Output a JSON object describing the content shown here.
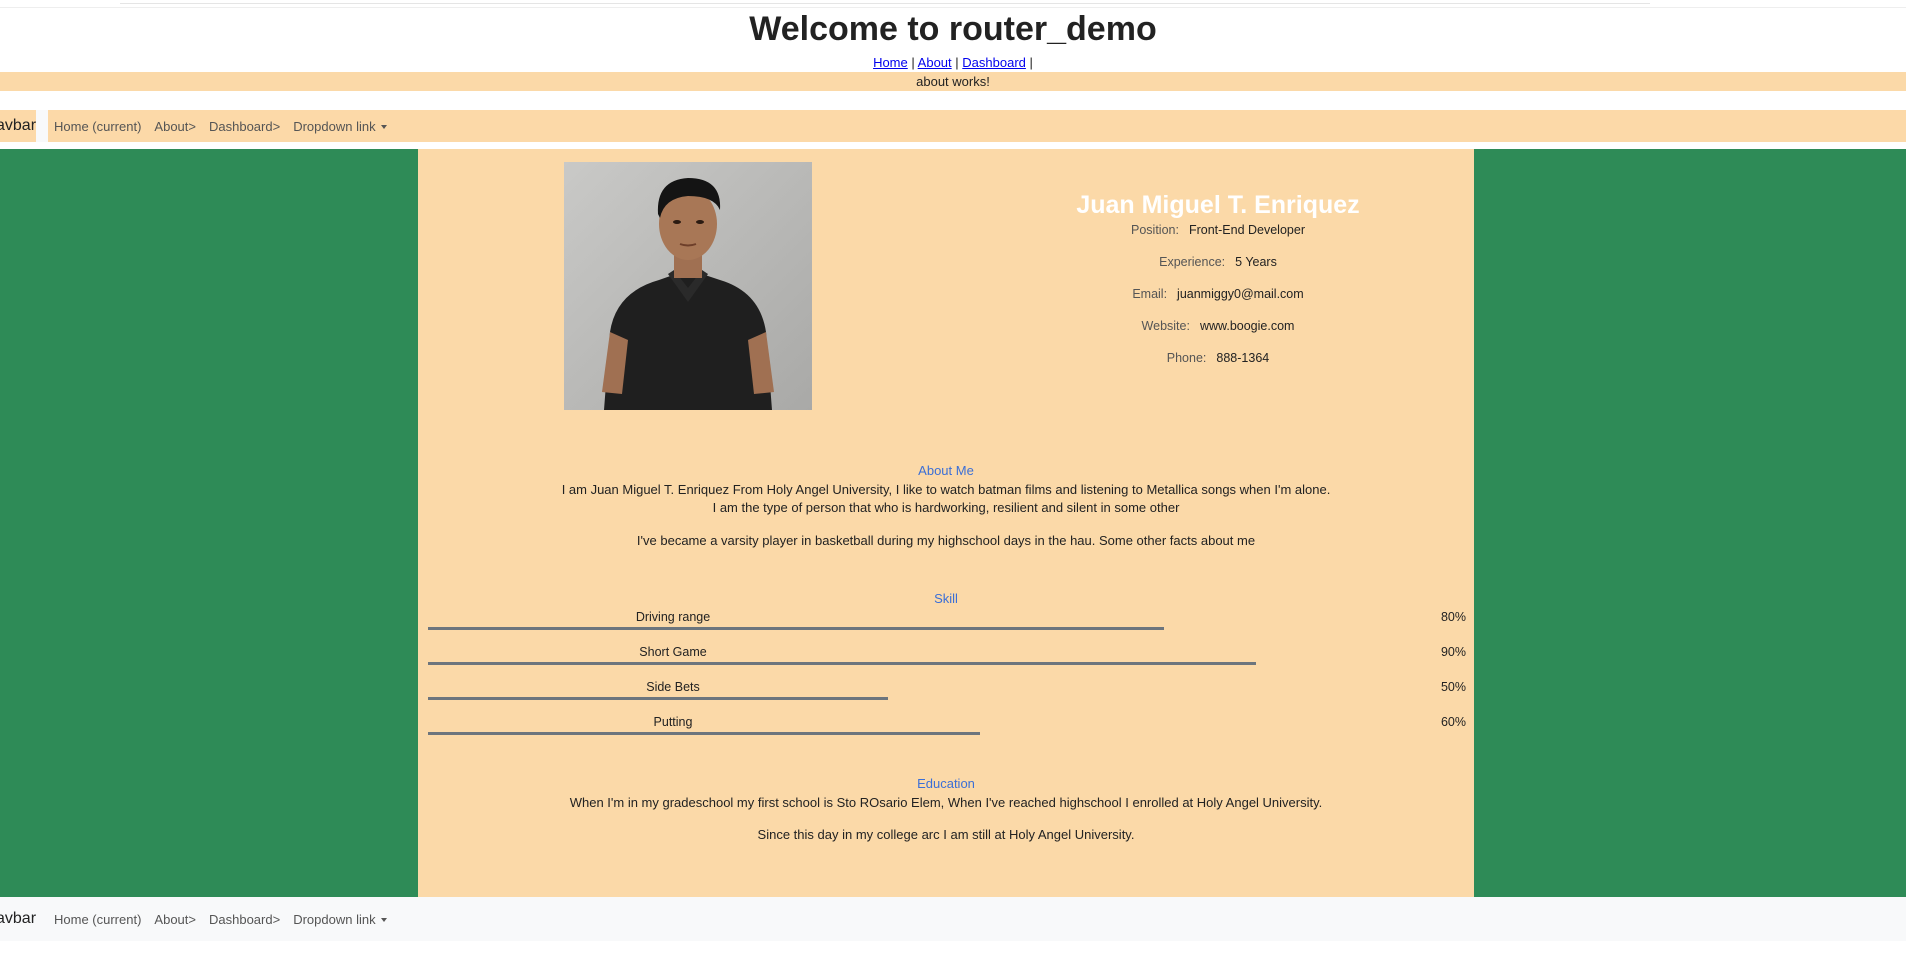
{
  "app": {
    "title": "Welcome to router_demo"
  },
  "router_links": {
    "home": "Home",
    "about": "About",
    "dashboard": "Dashboard",
    "sep": "|"
  },
  "about_banner": "about works!",
  "navbar": {
    "brand": "avbar",
    "items": [
      "Home (current)",
      "About>",
      "Dashboard>",
      "Dropdown link"
    ]
  },
  "profile": {
    "name": "Juan Miguel T. Enriquez",
    "fields": [
      {
        "label": "Position:",
        "value": "Front-End Developer"
      },
      {
        "label": "Experience:",
        "value": "5 Years"
      },
      {
        "label": "Email:",
        "value": "juanmiggy0@mail.com"
      },
      {
        "label": "Website:",
        "value": "www.boogie.com"
      },
      {
        "label": "Phone:",
        "value": "888-1364"
      }
    ]
  },
  "about_me": {
    "title": "About Me",
    "line1": "I am Juan Miguel T. Enriquez From Holy Angel University, I like to watch batman films and listening to Metallica songs when I'm alone.",
    "line2": "I am the type of person that who is hardworking, resilient and silent in some other",
    "line3": "I've became a varsity player in basketball during my highschool days in the hau. Some other facts about me"
  },
  "skills": {
    "title": "Skill",
    "items": [
      {
        "name": "Driving range",
        "percent_label": "80%",
        "percent": 80
      },
      {
        "name": "Short Game",
        "percent_label": "90%",
        "percent": 90
      },
      {
        "name": "Side Bets",
        "percent_label": "50%",
        "percent": 50
      },
      {
        "name": "Putting",
        "percent_label": "60%",
        "percent": 60
      }
    ]
  },
  "education": {
    "title": "Education",
    "line1": "When I'm in my gradeschool my first school is Sto ROsario Elem, When I've reached highschool I enrolled at Holy Angel University.",
    "line2": "Since this day in my college arc I am still at Holy Angel University."
  },
  "colors": {
    "accent_green": "#2e8b57",
    "panel_peach": "#fbd9a8",
    "link_blue": "#3b6fd6"
  }
}
